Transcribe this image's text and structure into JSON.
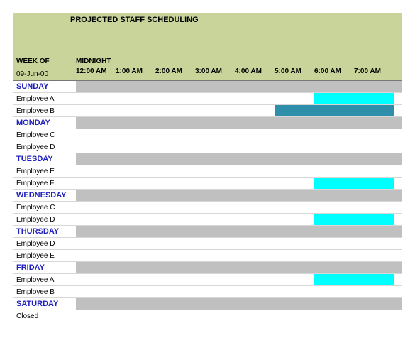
{
  "title": "PROJECTED STAFF SCHEDULING",
  "week_label": "WEEK OF",
  "midnight_label": "MIDNIGHT",
  "week_date": "09-Jun-00",
  "hours": [
    "12:00 AM",
    "1:00 AM",
    "2:00 AM",
    "3:00 AM",
    "4:00 AM",
    "5:00 AM",
    "6:00 AM",
    "7:00 AM"
  ],
  "schedule": [
    {
      "type": "day",
      "label": "SUNDAY"
    },
    {
      "type": "emp",
      "label": "Employee A",
      "cells": [
        "",
        "",
        "",
        "",
        "",
        "",
        "cyan",
        "cyan"
      ]
    },
    {
      "type": "emp",
      "label": "Employee B",
      "cells": [
        "",
        "",
        "",
        "",
        "",
        "teal",
        "teal",
        "teal"
      ]
    },
    {
      "type": "day",
      "label": "MONDAY"
    },
    {
      "type": "emp",
      "label": "Employee C",
      "cells": [
        "",
        "",
        "",
        "",
        "",
        "",
        "",
        ""
      ]
    },
    {
      "type": "emp",
      "label": "Employee D",
      "cells": [
        "",
        "",
        "",
        "",
        "",
        "",
        "",
        ""
      ]
    },
    {
      "type": "day",
      "label": "TUESDAY"
    },
    {
      "type": "emp",
      "label": "Employee E",
      "cells": [
        "",
        "",
        "",
        "",
        "",
        "",
        "",
        ""
      ]
    },
    {
      "type": "emp",
      "label": "Employee F",
      "cells": [
        "",
        "",
        "",
        "",
        "",
        "",
        "cyan",
        "cyan"
      ]
    },
    {
      "type": "day",
      "label": "WEDNESDAY"
    },
    {
      "type": "emp",
      "label": "Employee C",
      "cells": [
        "",
        "",
        "",
        "",
        "",
        "",
        "",
        ""
      ]
    },
    {
      "type": "emp",
      "label": "Employee D",
      "cells": [
        "",
        "",
        "",
        "",
        "",
        "",
        "cyan",
        "cyan"
      ]
    },
    {
      "type": "day",
      "label": "THURSDAY"
    },
    {
      "type": "emp",
      "label": "Employee D",
      "cells": [
        "",
        "",
        "",
        "",
        "",
        "",
        "",
        ""
      ]
    },
    {
      "type": "emp",
      "label": "Employee E",
      "cells": [
        "",
        "",
        "",
        "",
        "",
        "",
        "",
        ""
      ]
    },
    {
      "type": "day",
      "label": "FRIDAY"
    },
    {
      "type": "emp",
      "label": "Employee A",
      "cells": [
        "",
        "",
        "",
        "",
        "",
        "",
        "cyan",
        "cyan"
      ]
    },
    {
      "type": "emp",
      "label": "Employee B",
      "cells": [
        "",
        "",
        "",
        "",
        "",
        "",
        "",
        ""
      ]
    },
    {
      "type": "day",
      "label": "SATURDAY"
    },
    {
      "type": "emp",
      "label": "Closed",
      "cells": [
        "",
        "",
        "",
        "",
        "",
        "",
        "",
        ""
      ]
    }
  ]
}
